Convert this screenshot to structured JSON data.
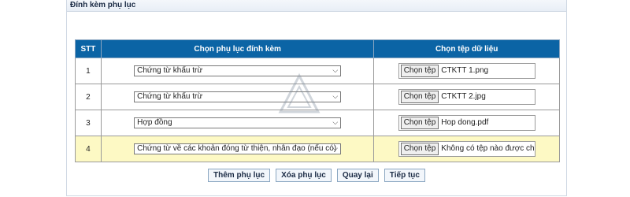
{
  "panel": {
    "title": "Đính kèm phụ lục"
  },
  "table": {
    "headers": [
      "STT",
      "Chọn phụ lục đính kèm",
      "Chọn tệp dữ liệu"
    ],
    "rows": [
      {
        "stt": "1",
        "appendix": "Chứng từ khấu trừ",
        "file_button": "Chọn tệp",
        "file_name": "CTKTT 1.png"
      },
      {
        "stt": "2",
        "appendix": "Chứng từ khấu trừ",
        "file_button": "Chọn tệp",
        "file_name": "CTKTT 2.jpg"
      },
      {
        "stt": "3",
        "appendix": "Hợp đồng",
        "file_button": "Chọn tệp",
        "file_name": "Hop dong.pdf"
      },
      {
        "stt": "4",
        "appendix": "Chứng từ về các khoản đóng từ thiện, nhân đạo (nếu có)",
        "file_button": "Chọn tệp",
        "file_name": "Không có tệp nào được chọn"
      }
    ]
  },
  "actions": {
    "add": "Thêm phụ lục",
    "delete": "Xóa phụ lục",
    "back": "Quay lại",
    "next": "Tiếp tục"
  },
  "colors": {
    "header_bg": "#0b64a5",
    "highlight_row": "#fdf9c4"
  },
  "icons": {
    "dropdown": "chevron-down-icon",
    "watermark": "logo-watermark"
  }
}
